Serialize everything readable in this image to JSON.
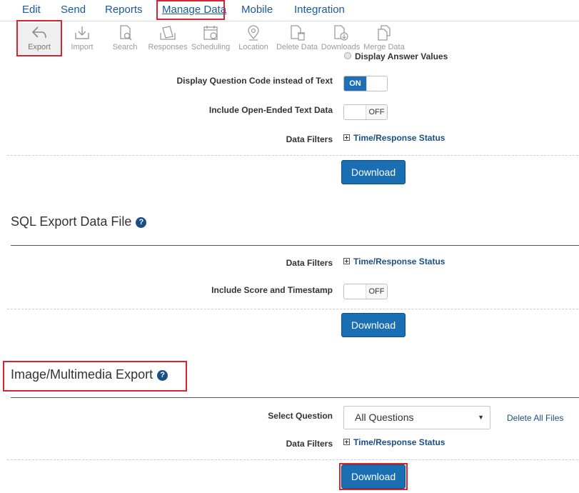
{
  "nav": {
    "items": [
      {
        "label": "Edit"
      },
      {
        "label": "Send"
      },
      {
        "label": "Reports"
      },
      {
        "label": "Manage Data"
      },
      {
        "label": "Mobile"
      },
      {
        "label": "Integration"
      }
    ]
  },
  "toolbar": {
    "tools": [
      {
        "label": "Export",
        "icon": "export-icon"
      },
      {
        "label": "Import",
        "icon": "import-icon"
      },
      {
        "label": "Search",
        "icon": "search-icon"
      },
      {
        "label": "Responses",
        "icon": "responses-icon"
      },
      {
        "label": "Scheduling",
        "icon": "calendar-icon"
      },
      {
        "label": "Location",
        "icon": "location-pin-icon"
      },
      {
        "label": "Delete Data",
        "icon": "delete-data-icon"
      },
      {
        "label": "Downloads",
        "icon": "downloads-icon"
      },
      {
        "label": "Merge Data",
        "icon": "merge-data-icon"
      }
    ]
  },
  "section1": {
    "answer_values_label": "Display Answer Values",
    "question_code_label": "Display Question Code instead of Text",
    "question_code_toggle": "ON",
    "open_ended_label": "Include Open-Ended Text Data",
    "open_ended_toggle": "OFF",
    "filters_label": "Data Filters",
    "filters_link": "Time/Response Status",
    "download_label": "Download"
  },
  "section_sql": {
    "title": "SQL Export Data File",
    "filters_label": "Data Filters",
    "filters_link": "Time/Response Status",
    "score_label": "Include Score and Timestamp",
    "score_toggle": "OFF",
    "download_label": "Download"
  },
  "section_media": {
    "title": "Image/Multimedia Export",
    "select_label": "Select Question",
    "select_value": "All Questions",
    "delete_all_label": "Delete All Files",
    "filters_label": "Data Filters",
    "filters_link": "Time/Response Status",
    "download_label": "Download"
  },
  "help_glyph": "?",
  "colors": {
    "accent": "#1a6fb3",
    "link": "#1a4f86",
    "highlight": "#d9232e"
  }
}
